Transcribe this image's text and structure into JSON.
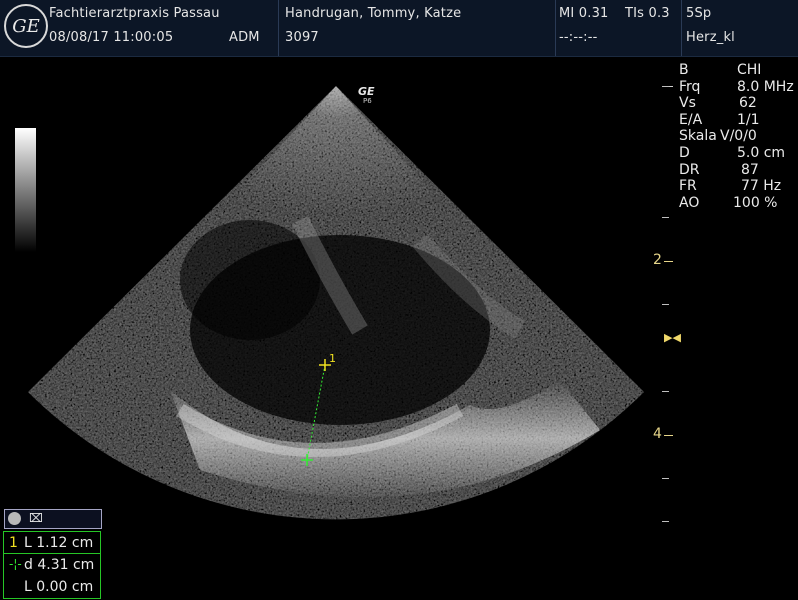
{
  "header": {
    "logo_text": "GE",
    "clinic": "Fachtierarztpraxis Passau",
    "datetime": "08/08/17 11:00:05",
    "operator": "ADM",
    "patient": "Handrugan, Tommy, Katze",
    "patient_id": "3097",
    "mi": "MI 0.31",
    "tis": "TIs 0.3",
    "probe": "5Sp",
    "time_field": "--:--:--",
    "preset": "Herz_kl"
  },
  "probe_marker": {
    "logo": "GE",
    "sub": "P6"
  },
  "params": [
    {
      "key": "B",
      "value": "CHI"
    },
    {
      "key": "Frq",
      "value": "8.0 MHz"
    },
    {
      "key": "Vs",
      "value": "62"
    },
    {
      "key": "E/A",
      "value": "1/1"
    },
    {
      "key": "Skala",
      "value": "V/0/0"
    },
    {
      "key": "D",
      "value": "5.0 cm"
    },
    {
      "key": "DR",
      "value": "87"
    },
    {
      "key": "FR",
      "value": "77 Hz"
    },
    {
      "key": "AO",
      "value": "100 %"
    }
  ],
  "depth_labels": [
    "2",
    "4"
  ],
  "focus_marker": "▶◀",
  "caliper_label": "1",
  "toolbox": {
    "cursor_icon": "⌧"
  },
  "measurements": {
    "box1": [
      {
        "mark": "1",
        "text": "L  1.12 cm"
      }
    ],
    "box2": [
      {
        "mark": "-¦-",
        "text": "d  4.31 cm"
      },
      {
        "mark": "",
        "text": "L  0.00 cm"
      }
    ]
  },
  "colors": {
    "header_bg": "#0c1626",
    "caliper_yellow": "#f0e020",
    "caliper_green": "#33ee33",
    "depth_yellow": "#e7d68a",
    "box_green": "#26c626"
  }
}
